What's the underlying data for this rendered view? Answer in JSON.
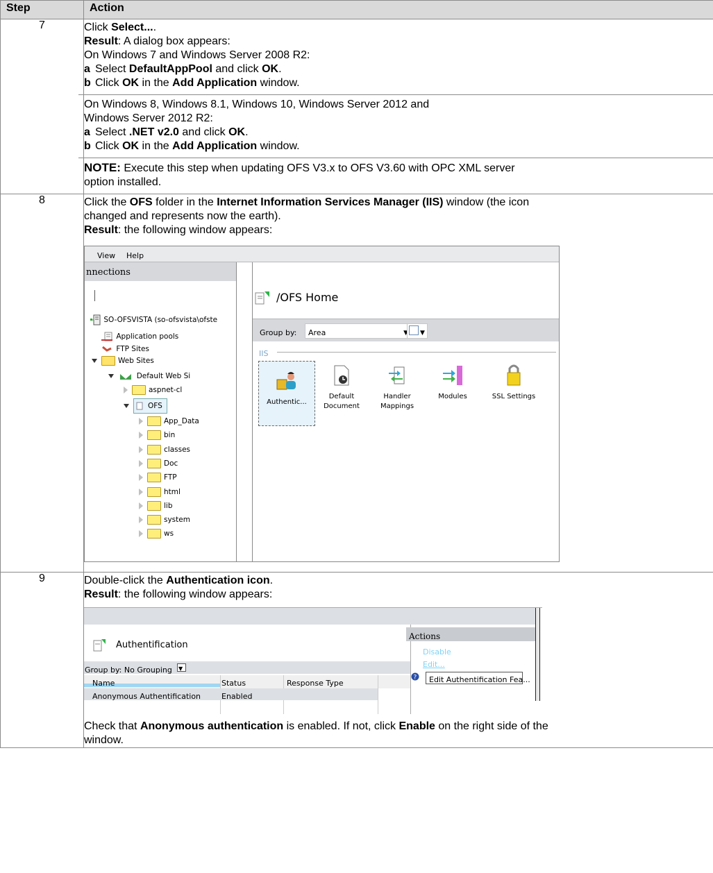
{
  "table": {
    "header_step": "Step",
    "header_action": "Action"
  },
  "step7": {
    "num": "7",
    "line1_pre": "Click ",
    "line1_bold": "Select...",
    "line1_post": ".",
    "result_label": "Result",
    "result_text": ": A dialog box appears:",
    "win7_heading": "On Windows 7 and Windows Server 2008 R2:",
    "win7_a_letter": "a",
    "win7_a_pre": "Select ",
    "win7_a_bold1": "DefaultAppPool",
    "win7_a_mid": " and click ",
    "win7_a_bold2": "OK",
    "win7_a_post": ".",
    "win7_b_letter": "b",
    "win7_b_pre": "Click ",
    "win7_b_bold1": "OK",
    "win7_b_mid": " in the ",
    "win7_b_bold2": "Add Application",
    "win7_b_post": " window.",
    "win8_heading1": "On Windows 8, Windows 8.1, Windows 10, Windows Server 2012 and",
    "win8_heading2": "Windows Server 2012 R2:",
    "win8_a_letter": "a",
    "win8_a_pre": "Select ",
    "win8_a_bold1": ".NET v2.0",
    "win8_a_mid": " and click ",
    "win8_a_bold2": "OK",
    "win8_a_post": ".",
    "win8_b_letter": "b",
    "win8_b_pre": "Click ",
    "win8_b_bold1": "OK",
    "win8_b_mid": " in the ",
    "win8_b_bold2": "Add Application",
    "win8_b_post": " window.",
    "note_label": "NOTE:",
    "note_text1": " Execute this step when updating OFS V3.x to OFS V3.60 with OPC XML server",
    "note_text2": "option installed."
  },
  "step8": {
    "num": "8",
    "pre": "Click the ",
    "bold1": "OFS",
    "mid1": " folder in the ",
    "bold2": "Internet Information Services Manager (IIS)",
    "mid2": " window (the icon",
    "line2": "changed and represents now the earth).",
    "result_label": "Result",
    "result_text": ": the following window appears:"
  },
  "iis": {
    "menu_view": "View",
    "menu_help": "Help",
    "connections": "nnections",
    "server": "SO-OFSVISTA  (so-ofsvista\\ofste",
    "app_pools": "Application  pools",
    "ftp_sites": "FTP  Sites",
    "web_sites": "Web  Sites",
    "default_web": "Default  Web  Si",
    "aspnet": "aspnet-cl",
    "ofs": "OFS",
    "folders": [
      "App_Data",
      "bin",
      "classes",
      "Doc",
      "FTP",
      "html",
      "lib",
      "system",
      "ws"
    ],
    "home_title": "/OFS Home",
    "group_by_label": "Group by:",
    "group_by_value": "Area",
    "section": "IIS",
    "features": {
      "auth": "Authentic...",
      "default_doc_1": "Default",
      "default_doc_2": "Document",
      "handler_1": "Handler",
      "handler_2": "Mappings",
      "modules": "Modules",
      "ssl": "SSL Settings"
    }
  },
  "step9": {
    "num": "9",
    "pre": "Double-click the ",
    "bold1": "Authentication icon",
    "post": ".",
    "result_label": "Result",
    "result_text": ": the following window appears:",
    "check_pre": "Check that ",
    "check_bold1": "Anonymous authentication",
    "check_mid": " is enabled. If not, click ",
    "check_bold2": "Enable",
    "check_post": " on the right side of the",
    "check_line2": "window."
  },
  "auth": {
    "title": "Authentification",
    "group_by": "Group by: No Grouping",
    "col_name": "Name",
    "col_status": "Status",
    "col_response": "Response Type",
    "row_name": "Anonymous Authentification",
    "row_status": "Enabled",
    "actions_title": "Actions",
    "action_disable": "Disable",
    "action_edit": "Edit...",
    "tooltip": "Edit Authentification Fea..."
  }
}
